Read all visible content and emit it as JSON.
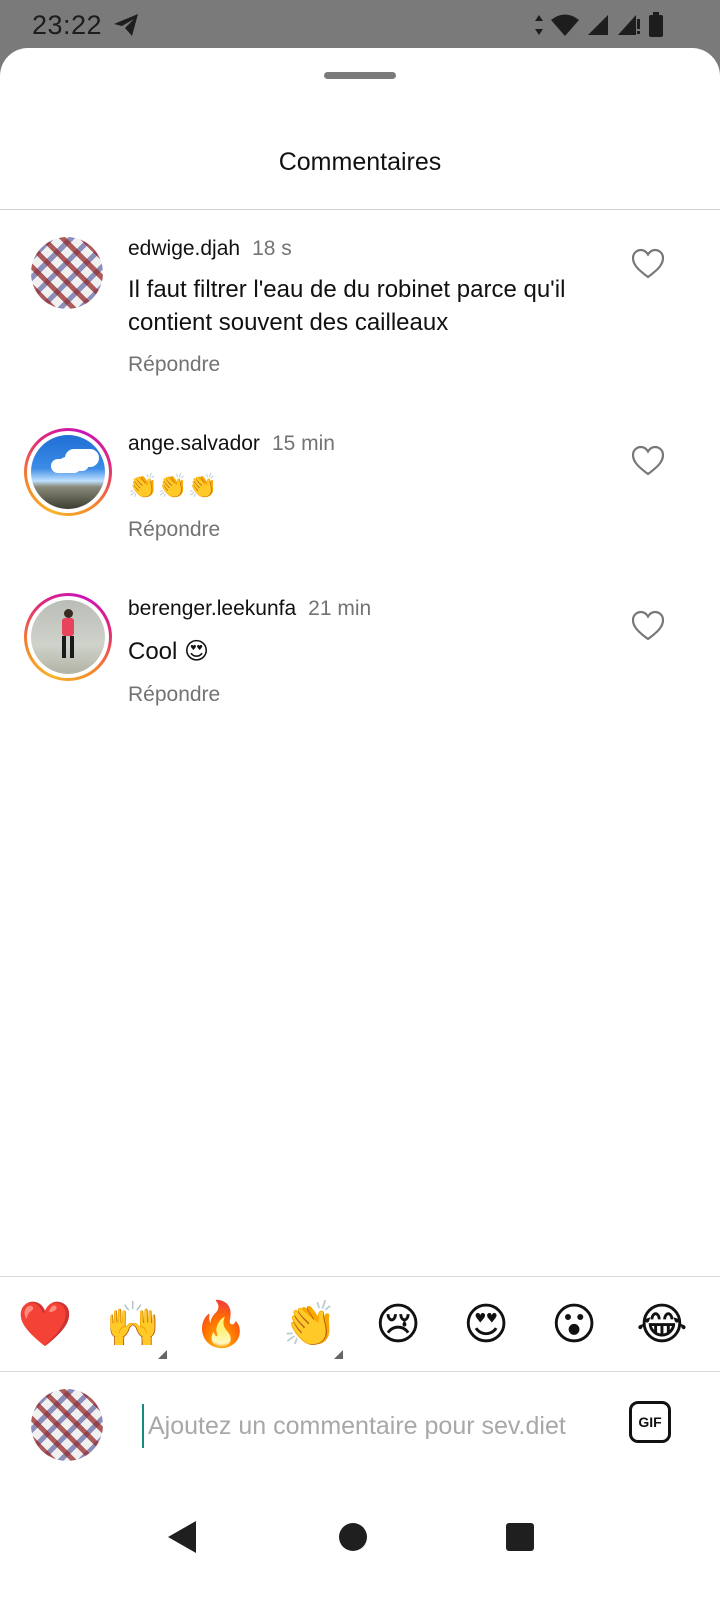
{
  "status_bar": {
    "time": "23:22",
    "icons": [
      "telegram-icon",
      "data-arrows-icon",
      "wifi-icon",
      "signal-icon",
      "signal-alert-icon",
      "battery-icon"
    ]
  },
  "sheet": {
    "title": "Commentaires"
  },
  "comments": [
    {
      "username": "edwige.djah",
      "time": "18 s",
      "text": "Il faut filtrer l'eau de du robinet parce qu'il contient souvent des cailleaux",
      "reply_label": "Répondre"
    },
    {
      "username": "ange.salvador",
      "time": "15 min",
      "text": "👏👏👏",
      "reply_label": "Répondre"
    },
    {
      "username": "berenger.leekunfa",
      "time": "21 min",
      "text": "Cool 😍",
      "reply_label": "Répondre"
    }
  ],
  "reactions": [
    "❤️",
    "🙌",
    "🔥",
    "👏",
    "😢",
    "😍",
    "😮",
    "😂"
  ],
  "composer": {
    "placeholder": "Ajoutez un commentaire pour sev.diet",
    "gif_label": "GIF"
  },
  "colors": {
    "accent_ring_start": "#f58529",
    "accent_ring_end": "#c913b9",
    "secondary_text": "#737373",
    "status_bar_bg": "#7a7a7a"
  }
}
